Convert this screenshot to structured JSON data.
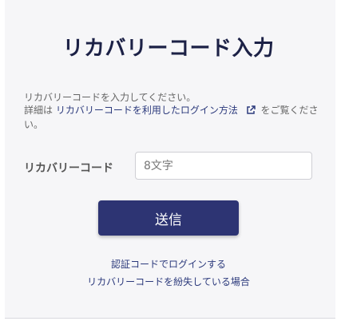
{
  "page": {
    "title": "リカバリーコード入力"
  },
  "description": {
    "line1": "リカバリーコードを入力してください。",
    "prefix": "詳細は ",
    "link_text": "リカバリーコードを利用したログイン方法",
    "suffix": "をご覧ください。"
  },
  "form": {
    "code_label": "リカバリーコード",
    "code_placeholder": "8文字",
    "submit_label": "送信"
  },
  "links": {
    "auth_code_login": "認証コードでログインする",
    "lost_recovery_code": "リカバリーコードを紛失している場合"
  },
  "colors": {
    "title": "#1c2146",
    "button": "#2d3473",
    "link": "#2c3a7c"
  },
  "icons": {
    "external_link": "external-link-icon"
  }
}
